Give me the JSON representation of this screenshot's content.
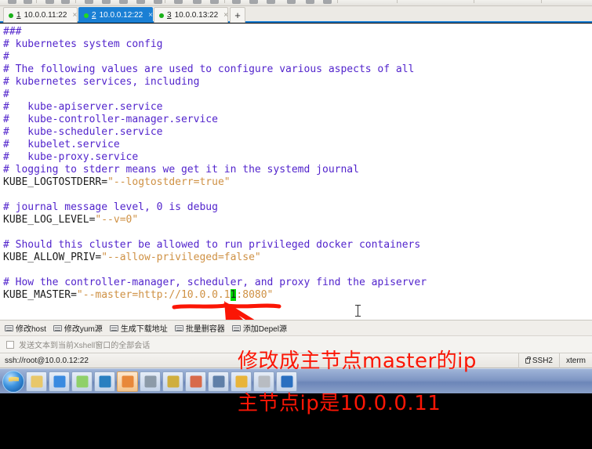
{
  "window": {
    "app": "Xshell",
    "toolbar_icons": [
      "new-session-icon",
      "open-icon",
      "save-icon",
      "search-icon",
      "reconnect-icon",
      "disconnect-icon",
      "copy-icon",
      "paste-icon",
      "clear-icon",
      "print-icon",
      "log-icon",
      "transfer-icon",
      "properties-icon",
      "find-icon",
      "compose-icon",
      "highlight-icon",
      "tunnel-icon",
      "help-icon"
    ]
  },
  "tabs": {
    "items": [
      {
        "num": "1",
        "label": "10.0.0.11:22",
        "active": false,
        "status": "connected"
      },
      {
        "num": "2",
        "label": "10.0.0.12:22",
        "active": true,
        "status": "connected"
      },
      {
        "num": "3",
        "label": "10.0.0.13:22",
        "active": false,
        "status": "connected"
      }
    ],
    "close_glyph": "×",
    "new_tab_label": "+"
  },
  "terminal": {
    "lines": [
      {
        "segments": [
          {
            "t": "###",
            "c": "cmt"
          }
        ]
      },
      {
        "segments": [
          {
            "t": "# kubernetes system config",
            "c": "cmt"
          }
        ]
      },
      {
        "segments": [
          {
            "t": "#",
            "c": "cmt"
          }
        ]
      },
      {
        "segments": [
          {
            "t": "# The following values are used to configure various aspects of all",
            "c": "cmt"
          }
        ]
      },
      {
        "segments": [
          {
            "t": "# kubernetes services, including",
            "c": "cmt"
          }
        ]
      },
      {
        "segments": [
          {
            "t": "#",
            "c": "cmt"
          }
        ]
      },
      {
        "segments": [
          {
            "t": "#   kube-apiserver.service",
            "c": "cmt"
          }
        ]
      },
      {
        "segments": [
          {
            "t": "#   kube-controller-manager.service",
            "c": "cmt"
          }
        ]
      },
      {
        "segments": [
          {
            "t": "#   kube-scheduler.service",
            "c": "cmt"
          }
        ]
      },
      {
        "segments": [
          {
            "t": "#   kubelet.service",
            "c": "cmt"
          }
        ]
      },
      {
        "segments": [
          {
            "t": "#   kube-proxy.service",
            "c": "cmt"
          }
        ]
      },
      {
        "segments": [
          {
            "t": "# logging to stderr means we get it in the systemd journal",
            "c": "cmt"
          }
        ]
      },
      {
        "segments": [
          {
            "t": "KUBE_LOGTOSTDERR=",
            "c": "var"
          },
          {
            "t": "\"--logtostderr=true\"",
            "c": "str"
          }
        ]
      },
      {
        "segments": [
          {
            "t": "",
            "c": "var"
          }
        ]
      },
      {
        "segments": [
          {
            "t": "# journal message level, 0 is debug",
            "c": "cmt"
          }
        ]
      },
      {
        "segments": [
          {
            "t": "KUBE_LOG_LEVEL=",
            "c": "var"
          },
          {
            "t": "\"--v=0\"",
            "c": "str"
          }
        ]
      },
      {
        "segments": [
          {
            "t": "",
            "c": "var"
          }
        ]
      },
      {
        "segments": [
          {
            "t": "# Should this cluster be allowed to run privileged docker containers",
            "c": "cmt"
          }
        ]
      },
      {
        "segments": [
          {
            "t": "KUBE_ALLOW_PRIV=",
            "c": "var"
          },
          {
            "t": "\"--allow-privileged=false\"",
            "c": "str"
          }
        ]
      },
      {
        "segments": [
          {
            "t": "",
            "c": "var"
          }
        ]
      },
      {
        "segments": [
          {
            "t": "# How the controller-manager, scheduler, and proxy find the apiserver",
            "c": "cmt"
          }
        ]
      },
      {
        "segments": [
          {
            "t": "KUBE_MASTER=",
            "c": "var"
          },
          {
            "t": "\"--master=http://10.0.0.1",
            "c": "str"
          },
          {
            "t": "1",
            "c": "cursor"
          },
          {
            "t": ":8080\"",
            "c": "str"
          }
        ]
      }
    ],
    "cursor_char": "1",
    "colors": {
      "background": "#ffffff",
      "comment": "#5224cc",
      "variable": "#1d1d1d",
      "string": "#cf9144",
      "cursor_bg": "#00d900"
    }
  },
  "quickbar": {
    "items": [
      {
        "label": "修改host"
      },
      {
        "label": "修改yum源"
      },
      {
        "label": "生成下载地址"
      },
      {
        "label": "批量删容器"
      },
      {
        "label": "添加Depel源"
      }
    ]
  },
  "send_to_all": {
    "label": "发送文本到当前Xshell窗口的全部会话",
    "checked": false
  },
  "statusbar": {
    "connection": "ssh://root@10.0.0.12:22",
    "protocol": "SSH2",
    "terminal_type": "xterm"
  },
  "taskbar": {
    "start_label": "Start",
    "buttons": [
      {
        "name": "explorer",
        "color": "#e8c76a"
      },
      {
        "name": "chrome",
        "color": "#3a8ae0"
      },
      {
        "name": "notepad",
        "color": "#8fd06a"
      },
      {
        "name": "media-player",
        "color": "#2a7fc0"
      },
      {
        "name": "firefox",
        "color": "#e8883a",
        "active": true
      },
      {
        "name": "vmware",
        "color": "#8c9aa8"
      },
      {
        "name": "putty",
        "color": "#cfae3e"
      },
      {
        "name": "paint",
        "color": "#d86a4a"
      },
      {
        "name": "xftp",
        "color": "#5f7fa8"
      },
      {
        "name": "xshell",
        "color": "#e8b43a"
      },
      {
        "name": "text-tool",
        "color": "#b8bcc2"
      },
      {
        "name": "navicat",
        "color": "#2a6fc0"
      }
    ]
  },
  "annotations": {
    "line1": "修改成主节点master的ip",
    "line2": "主节点ip是10.0.0.11",
    "color": "#fb1605",
    "arrow": {
      "points_to": "terminal-cursor",
      "color": "#fb1605"
    }
  }
}
